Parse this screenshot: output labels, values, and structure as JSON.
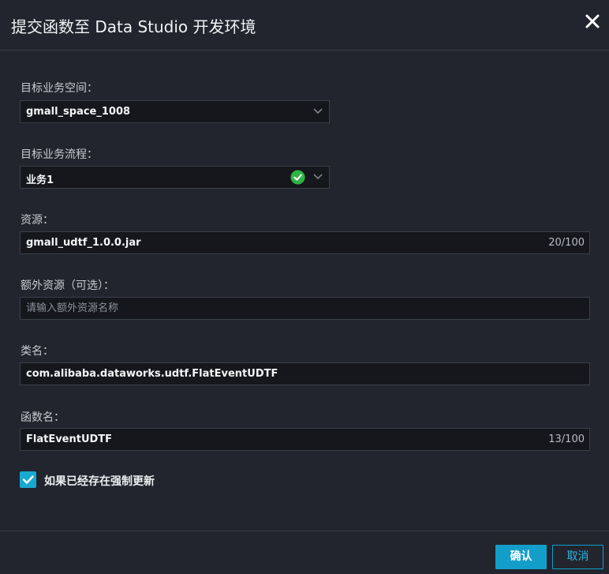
{
  "dialog": {
    "title": "提交函数至 Data Studio 开发环境"
  },
  "fields": {
    "workspace": {
      "label": "目标业务空间：",
      "value": "gmall_space_1008"
    },
    "workflow": {
      "label": "目标业务流程：",
      "value": "业务1"
    },
    "resource": {
      "label": "资源：",
      "value": "gmall_udtf_1.0.0.jar",
      "counter": "20/100"
    },
    "extra_resource": {
      "label": "额外资源（可选）：",
      "placeholder": "请输入额外资源名称"
    },
    "class_name": {
      "label": "类名：",
      "value": "com.alibaba.dataworks.udtf.FlatEventUDTF"
    },
    "function_name": {
      "label": "函数名：",
      "value": "FlatEventUDTF",
      "counter": "13/100"
    }
  },
  "force_update": {
    "label": "如果已经存在强制更新",
    "checked": true
  },
  "footer": {
    "confirm_label": "确认",
    "cancel_label": "取消"
  },
  "colors": {
    "background": "#22252d",
    "input_background": "#15171c",
    "accent": "#139ec9",
    "success": "#2fb344"
  },
  "icons": {
    "close": "close-icon",
    "dropdown": "chevron-down-icon",
    "valid": "check-circle-icon",
    "checkbox": "checkmark-icon"
  }
}
